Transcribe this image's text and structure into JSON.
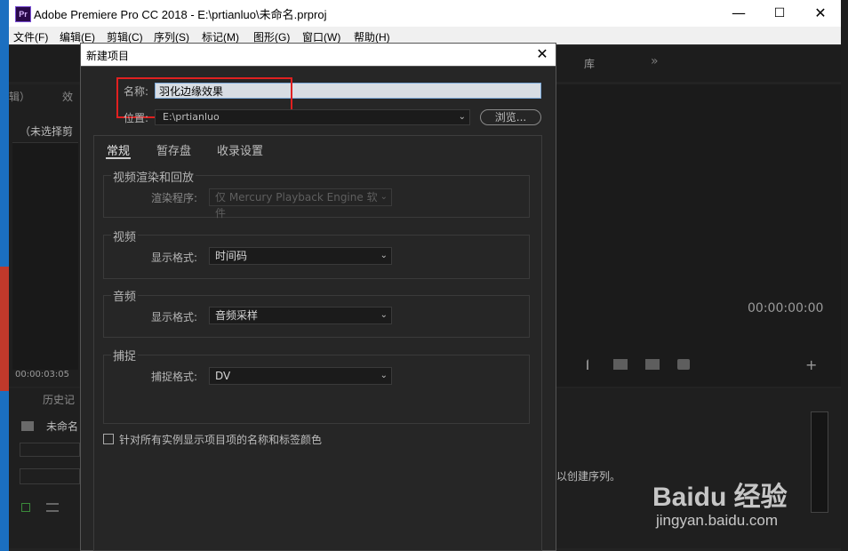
{
  "window": {
    "icon_text": "Pr",
    "title": "Adobe Premiere Pro CC 2018 - E:\\prtianluo\\未命名.prproj",
    "min_symbol": "—",
    "max_symbol": "☐",
    "close_symbol": "✕"
  },
  "menu": [
    "文件(F)",
    "编辑(E)",
    "剪辑(C)",
    "序列(S)",
    "标记(M)",
    "图形(G)",
    "窗口(W)",
    "帮助(H)"
  ],
  "background": {
    "left_tabs": "辑）",
    "left_tab2": "效",
    "no_selection": "（未选择剪",
    "timecode_left": "00:00:03:05",
    "history_label": "历史记",
    "project_item": "未命名",
    "right_tab": "库",
    "right_more": "»",
    "timecode_right": "00:00:00:00",
    "hint_text": "以创建序列。",
    "add_symbol": "+"
  },
  "dialog": {
    "title": "新建项目",
    "close_symbol": "✕",
    "name_label": "名称:",
    "name_value": "羽化边缘效果",
    "location_label": "位置:",
    "location_value": "E:\\prtianluo",
    "browse_label": "浏览...",
    "tabs": [
      "常规",
      "暂存盘",
      "收录设置"
    ],
    "video_render": {
      "title": "视频渲染和回放",
      "renderer_label": "渲染程序:",
      "renderer_value": "仅 Mercury Playback Engine 软件"
    },
    "video": {
      "title": "视频",
      "format_label": "显示格式:",
      "format_value": "时间码"
    },
    "audio": {
      "title": "音频",
      "format_label": "显示格式:",
      "format_value": "音频采样"
    },
    "capture": {
      "title": "捕捉",
      "format_label": "捕捉格式:",
      "format_value": "DV"
    },
    "checkbox_label": "针对所有实例显示项目项的名称和标签颜色",
    "chevron": "⌄"
  },
  "watermark": {
    "brand_text": "Baidu 经验",
    "url_text": "jingyan.baidu.com"
  }
}
